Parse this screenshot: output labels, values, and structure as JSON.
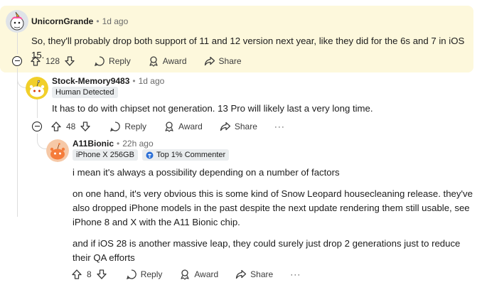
{
  "comments": [
    {
      "author": "UnicornGrande",
      "time": "1d ago",
      "body": "So, they'll probably drop both support of 11 and 12 version next year, like they did for the 6s and 7 in iOS 15.",
      "votes": "128",
      "actions": {
        "reply": "Reply",
        "award": "Award",
        "share": "Share"
      }
    },
    {
      "author": "Stock-Memory9483",
      "time": "1d ago",
      "flair": "Human Detected",
      "body": "It has to do with chipset not generation. 13 Pro will likely last a very long time.",
      "votes": "48",
      "actions": {
        "reply": "Reply",
        "award": "Award",
        "share": "Share"
      }
    },
    {
      "author": "A11Bionic",
      "time": "22h ago",
      "flair": "iPhone X 256GB",
      "badge": "Top 1% Commenter",
      "paragraphs": [
        "i mean it's always a possibility depending on a number of factors",
        "on one hand, it's very obvious this is some kind of Snow Leopard housecleaning release. they've also dropped iPhone models in the past despite the next update rendering them still usable, see iPhone 8 and X with the A11 Bionic chip.",
        "and if iOS 28 is another massive leap, they could surely just drop 2 generations just to reduce their QA efforts"
      ],
      "votes": "8",
      "actions": {
        "reply": "Reply",
        "award": "Award",
        "share": "Share"
      }
    }
  ],
  "separator": "•",
  "more_label": "···",
  "icons": [
    "upvote-icon",
    "downvote-icon",
    "reply-icon",
    "award-icon",
    "share-icon",
    "collapse-icon",
    "more-icon"
  ],
  "colors": {
    "highlight": "#fdf8dc",
    "flair_bg": "#eaedef",
    "thread_line": "#dcdcdc"
  }
}
